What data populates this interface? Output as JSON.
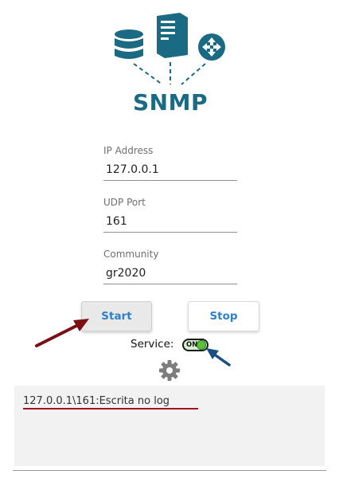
{
  "logo": {
    "text": "SNMP",
    "icons": [
      "database-icon",
      "server-icon",
      "router-icon"
    ],
    "color": "#1b6a84"
  },
  "form": {
    "ip": {
      "label": "IP Address",
      "value": "127.0.0.1"
    },
    "port": {
      "label": "UDP Port",
      "value": "161"
    },
    "community": {
      "label": "Community",
      "value": "gr2020"
    }
  },
  "buttons": {
    "start": "Start",
    "stop": "Stop"
  },
  "service": {
    "label": "Service:",
    "toggle_text": "ON",
    "state": "on"
  },
  "settings_icon": "gear-icon",
  "log": {
    "lines": [
      "127.0.0.1\\161:Escrita no log"
    ]
  },
  "annotations": {
    "arrow_red_color": "#7a0f14",
    "arrow_blue_color": "#164f82",
    "underline_color": "#a4121a"
  }
}
